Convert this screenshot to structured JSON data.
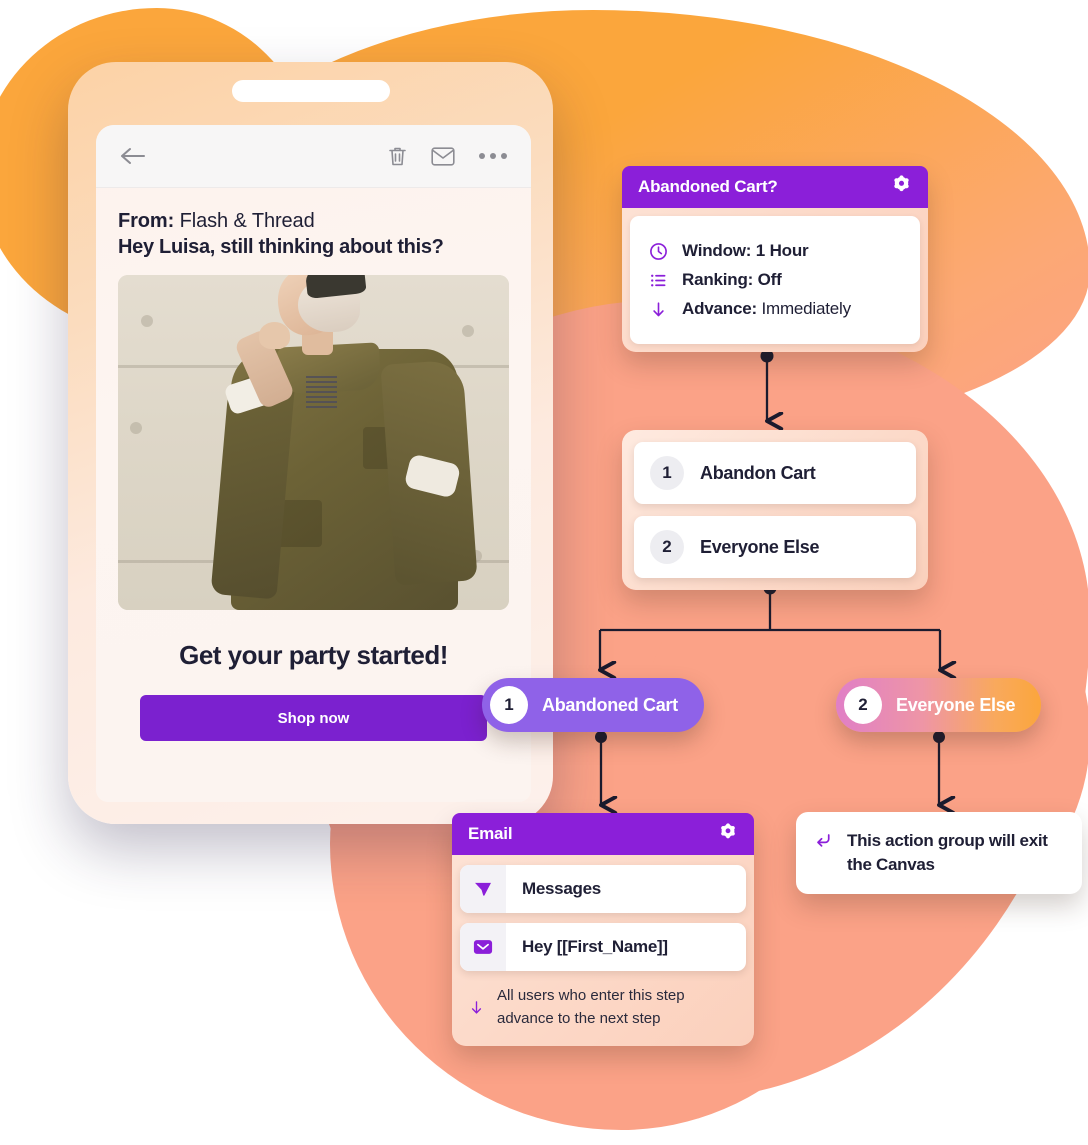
{
  "phone": {
    "toolbar": {
      "back_icon": "back-arrow-icon",
      "delete_icon": "trash-icon",
      "mail_icon": "envelope-icon",
      "more_icon": "more-dots-icon"
    },
    "email": {
      "from_label": "From:",
      "from_value": " Flash & Thread",
      "subject": "Hey Luisa, still thinking about this?",
      "hero_alt": "Model wearing olive utility jacket",
      "headline": "Get your party started!",
      "cta_label": "Shop now"
    }
  },
  "flow": {
    "trigger": {
      "title": "Abandoned Cart?",
      "settings_icon": "gear-icon",
      "rows": [
        {
          "icon": "clock-icon",
          "bold": "Window:",
          "value": " 1 Hour",
          "value_bold": true
        },
        {
          "icon": "list-icon",
          "bold": "Ranking:",
          "value": " Off",
          "value_bold": true
        },
        {
          "icon": "arrow-down-icon",
          "bold": "Advance:",
          "value": " Immediately",
          "value_bold": false
        }
      ]
    },
    "groups": [
      {
        "num": "1",
        "label": "Abandon Cart"
      },
      {
        "num": "2",
        "label": "Everyone Else"
      }
    ],
    "branches": [
      {
        "num": "1",
        "label": "Abandoned Cart"
      },
      {
        "num": "2",
        "label": "Everyone Else"
      }
    ],
    "email_node": {
      "title": "Email",
      "settings_icon": "gear-icon",
      "rows": [
        {
          "icon": "send-icon",
          "label": "Messages"
        },
        {
          "icon": "envelope-icon",
          "label": "Hey [[First_Name]]"
        }
      ],
      "note_icon": "arrow-down-icon",
      "note": "All users who enter this step advance to the next step"
    },
    "exit_node": {
      "icon": "exit-return-icon",
      "text": "This action group will exit the Canvas"
    }
  },
  "colors": {
    "purple": "#8B1FD9",
    "purple_button": "#7B21CF",
    "pill_violet": "#8F62E8",
    "orange": "#FBA63C",
    "salmon": "#FBA287",
    "ink": "#1F1F35"
  }
}
